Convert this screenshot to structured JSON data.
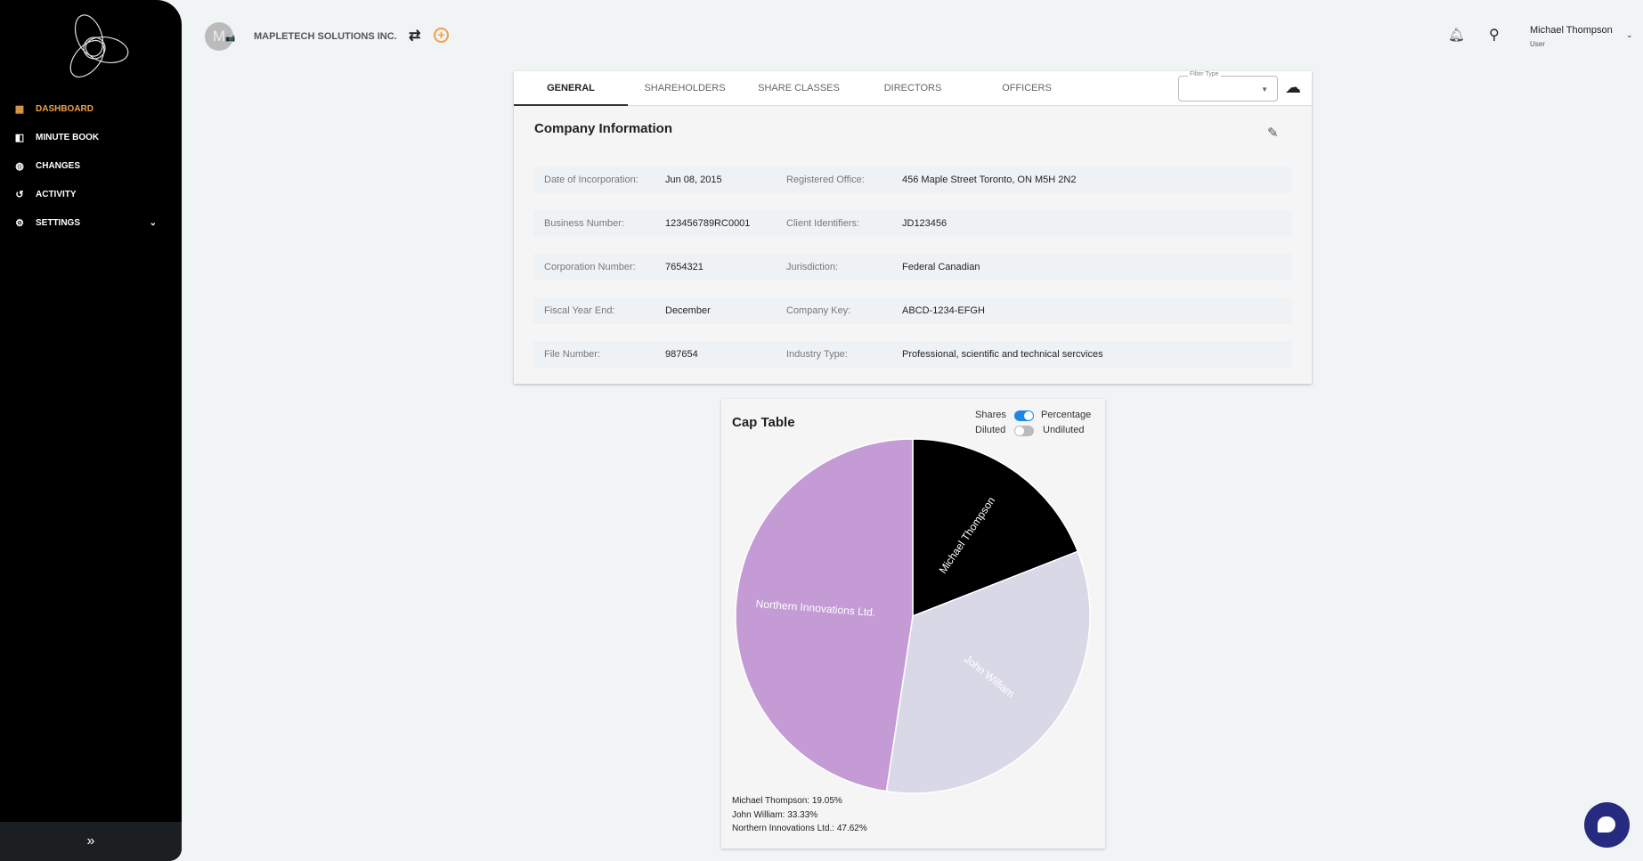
{
  "sidebar": {
    "items": [
      {
        "label": "DASHBOARD",
        "icon": "dashboard-icon"
      },
      {
        "label": "MINUTE BOOK",
        "icon": "book-icon"
      },
      {
        "label": "CHANGES",
        "icon": "globe-icon"
      },
      {
        "label": "ACTIVITY",
        "icon": "history-icon"
      },
      {
        "label": "SETTINGS",
        "icon": "gear-icon"
      }
    ],
    "collapse": "»"
  },
  "header": {
    "avatar_initial": "M",
    "company": "MAPLETECH SOLUTIONS INC.",
    "user_name": "Michael Thompson",
    "user_role": "User"
  },
  "tabs": [
    "GENERAL",
    "SHAREHOLDERS",
    "SHARE CLASSES",
    "DIRECTORS",
    "OFFICERS"
  ],
  "filter": {
    "label": "Filter Type",
    "value": ""
  },
  "company_info": {
    "title": "Company Information",
    "rows": [
      [
        "Date of Incorporation:",
        "Jun 08, 2015",
        "Registered Office:",
        "456 Maple Street Toronto, ON M5H 2N2"
      ],
      [
        "Business Number:",
        "123456789RC0001",
        "Client Identifiers:",
        "JD123456"
      ],
      [
        "Corporation Number:",
        "7654321",
        "Jurisdiction:",
        "Federal Canadian"
      ],
      [
        "Fiscal Year End:",
        "December",
        "Company Key:",
        "ABCD-1234-EFGH"
      ],
      [
        "File Number:",
        "987654",
        "Industry Type:",
        "Professional, scientific and technical sercvices"
      ]
    ]
  },
  "cap_table": {
    "title": "Cap Table",
    "toggle1": {
      "left": "Shares",
      "right": "Percentage",
      "on": true
    },
    "toggle2": {
      "left": "Diluted",
      "right": "Undiluted",
      "on": false
    },
    "legend": [
      "Michael Thompson: 19.05%",
      "John William: 33.33%",
      "Northern Innovations Ltd.: 47.62%"
    ]
  },
  "chart_data": {
    "type": "pie",
    "title": "Cap Table",
    "labels": [
      "Michael Thompson",
      "John William",
      "Northern Innovations Ltd."
    ],
    "values": [
      19.05,
      33.33,
      47.62
    ],
    "colors": [
      "#000000",
      "#d9d8e6",
      "#c49bd5"
    ]
  }
}
